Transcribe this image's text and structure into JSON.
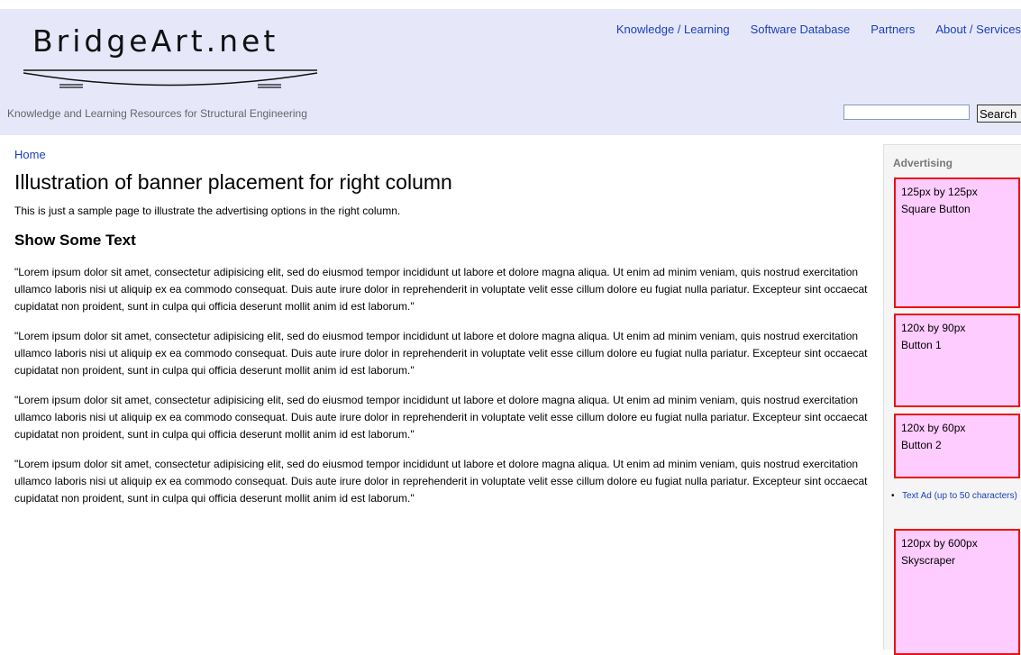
{
  "header": {
    "logo_text": "BridgeArt.net",
    "tagline": "Knowledge and Learning Resources for Structural Engineering",
    "nav": [
      {
        "label": "Knowledge / Learning"
      },
      {
        "label": "Software Database"
      },
      {
        "label": "Partners"
      },
      {
        "label": "About / Services"
      }
    ],
    "search": {
      "value": "",
      "button_label": "Search"
    }
  },
  "main": {
    "breadcrumb": "Home",
    "title": "Illustration of banner placement for right column",
    "intro": "This is just a sample page to illustrate the advertising options in the right column.",
    "section_heading": "Show Some Text",
    "paragraphs": [
      "\"Lorem ipsum dolor sit amet, consectetur adipisicing elit, sed do eiusmod tempor incididunt ut labore et dolore magna aliqua. Ut enim ad minim veniam, quis nostrud exercitation ullamco laboris nisi ut aliquip ex ea commodo consequat. Duis aute irure dolor in reprehenderit in voluptate velit esse cillum dolore eu fugiat nulla pariatur. Excepteur sint occaecat cupidatat non proident, sunt in culpa qui officia deserunt mollit anim id est laborum.\"",
      "\"Lorem ipsum dolor sit amet, consectetur adipisicing elit, sed do eiusmod tempor incididunt ut labore et dolore magna aliqua. Ut enim ad minim veniam, quis nostrud exercitation ullamco laboris nisi ut aliquip ex ea commodo consequat. Duis aute irure dolor in reprehenderit in voluptate velit esse cillum dolore eu fugiat nulla pariatur. Excepteur sint occaecat cupidatat non proident, sunt in culpa qui officia deserunt mollit anim id est laborum.\"",
      "\"Lorem ipsum dolor sit amet, consectetur adipisicing elit, sed do eiusmod tempor incididunt ut labore et dolore magna aliqua. Ut enim ad minim veniam, quis nostrud exercitation ullamco laboris nisi ut aliquip ex ea commodo consequat. Duis aute irure dolor in reprehenderit in voluptate velit esse cillum dolore eu fugiat nulla pariatur. Excepteur sint occaecat cupidatat non proident, sunt in culpa qui officia deserunt mollit anim id est laborum.\"",
      "\"Lorem ipsum dolor sit amet, consectetur adipisicing elit, sed do eiusmod tempor incididunt ut labore et dolore magna aliqua. Ut enim ad minim veniam, quis nostrud exercitation ullamco laboris nisi ut aliquip ex ea commodo consequat. Duis aute irure dolor in reprehenderit in voluptate velit esse cillum dolore eu fugiat nulla pariatur. Excepteur sint occaecat cupidatat non proident, sunt in culpa qui officia deserunt mollit anim id est laborum.\""
    ]
  },
  "sidebar": {
    "title": "Advertising",
    "ads": [
      {
        "line1": "125px by 125px",
        "line2": "Square Button"
      },
      {
        "line1": "120x by 90px",
        "line2": "Button 1"
      },
      {
        "line1": "120x by 60px",
        "line2": "Button 2"
      },
      {
        "line1": "120px by 600px",
        "line2": "Skyscraper"
      }
    ],
    "text_ad": "Text Ad (up to 50 characters)"
  },
  "colors": {
    "header_bg": "#e6e8fa",
    "link": "#1a3fb8",
    "ad_fill": "#ffccff",
    "ad_border": "#ee1111"
  }
}
